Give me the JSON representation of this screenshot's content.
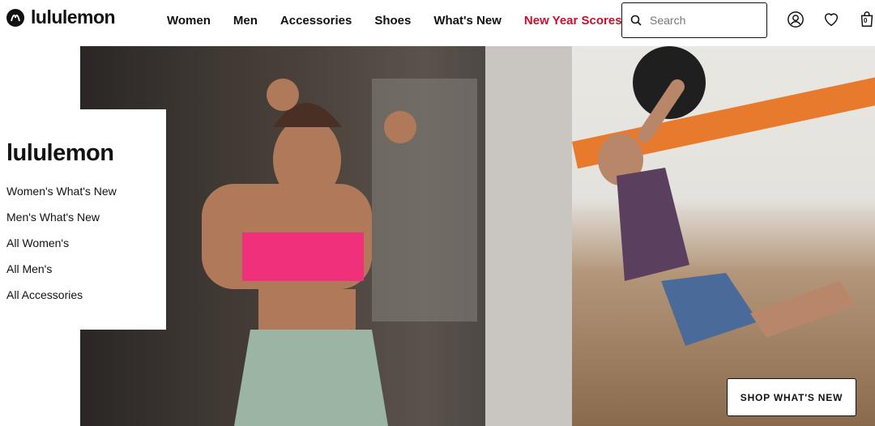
{
  "brand": {
    "name": "lululemon"
  },
  "nav": {
    "items": [
      {
        "label": "Women"
      },
      {
        "label": "Men"
      },
      {
        "label": "Accessories"
      },
      {
        "label": "Shoes"
      },
      {
        "label": "What's New"
      },
      {
        "label": "New Year Scores",
        "highlight": "#c8102e"
      }
    ]
  },
  "search": {
    "placeholder": "Search"
  },
  "header_icons": [
    "account-icon",
    "wishlist-heart-icon",
    "shopping-bag-icon"
  ],
  "bag": {
    "count": "0"
  },
  "side_panel": {
    "title": "lululemon",
    "links": [
      {
        "label": "Women's What's New"
      },
      {
        "label": "Men's What's New"
      },
      {
        "label": "All Women's"
      },
      {
        "label": "All Men's"
      },
      {
        "label": "All Accessories"
      }
    ]
  },
  "hero": {
    "cta_label": "SHOP WHAT'S NEW"
  }
}
